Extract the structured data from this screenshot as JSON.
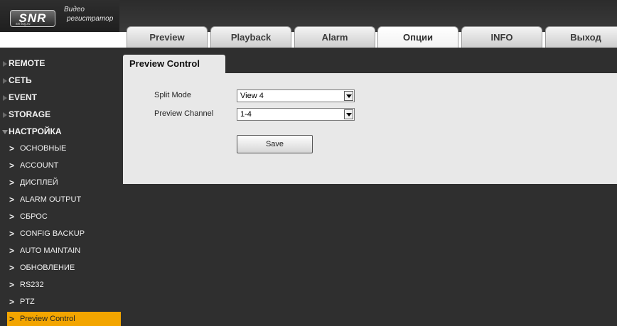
{
  "logo": {
    "mark": "SNR",
    "subtext": "snr.lug.ru",
    "line1": "Видео",
    "line2": "регистратор"
  },
  "tabs": [
    "Preview",
    "Playback",
    "Alarm",
    "Опции",
    "INFO",
    "Выход"
  ],
  "active_tab": "Опции",
  "sidebar": {
    "sections": [
      "REMOTE",
      "СЕТЬ",
      "EVENT",
      "STORAGE",
      "НАСТРОЙКА"
    ],
    "subitems": [
      "ОСНОВНЫЕ",
      "ACCOUNT",
      "ДИСПЛЕЙ",
      "ALARM OUTPUT",
      "СБРОС",
      "CONFIG BACKUP",
      "AUTO MAINTAIN",
      "ОБНОВЛЕНИЕ",
      "RS232",
      "PTZ",
      "Preview Control"
    ],
    "active_subitem": "Preview Control"
  },
  "panel": {
    "title": "Preview Control",
    "split_mode_label": "Split Mode",
    "split_mode_value": "View 4",
    "preview_channel_label": "Preview Channel",
    "preview_channel_value": "1-4",
    "save_label": "Save"
  },
  "colors": {
    "active_item_bg": "#f3a500",
    "sidebar_bg": "#2f2f2f",
    "panel_bg": "#e8e8e8"
  }
}
